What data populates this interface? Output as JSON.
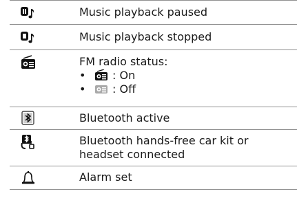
{
  "rows": [
    {
      "icon": "music-paused-icon",
      "text": "Music playback paused"
    },
    {
      "icon": "music-stopped-icon",
      "text": "Music playback stopped"
    },
    {
      "icon": "fm-radio-icon",
      "text": "FM radio status:",
      "bullets": [
        {
          "bullet": "•",
          "icon": "fm-radio-on-icon",
          "label": ": On"
        },
        {
          "bullet": "•",
          "icon": "fm-radio-off-icon",
          "label": ": Off"
        }
      ]
    },
    {
      "icon": "bluetooth-icon",
      "text": "Bluetooth active"
    },
    {
      "icon": "headset-icon",
      "text": "Bluetooth hands-free car kit or headset connected"
    },
    {
      "icon": "alarm-bell-icon",
      "text": "Alarm set"
    }
  ]
}
